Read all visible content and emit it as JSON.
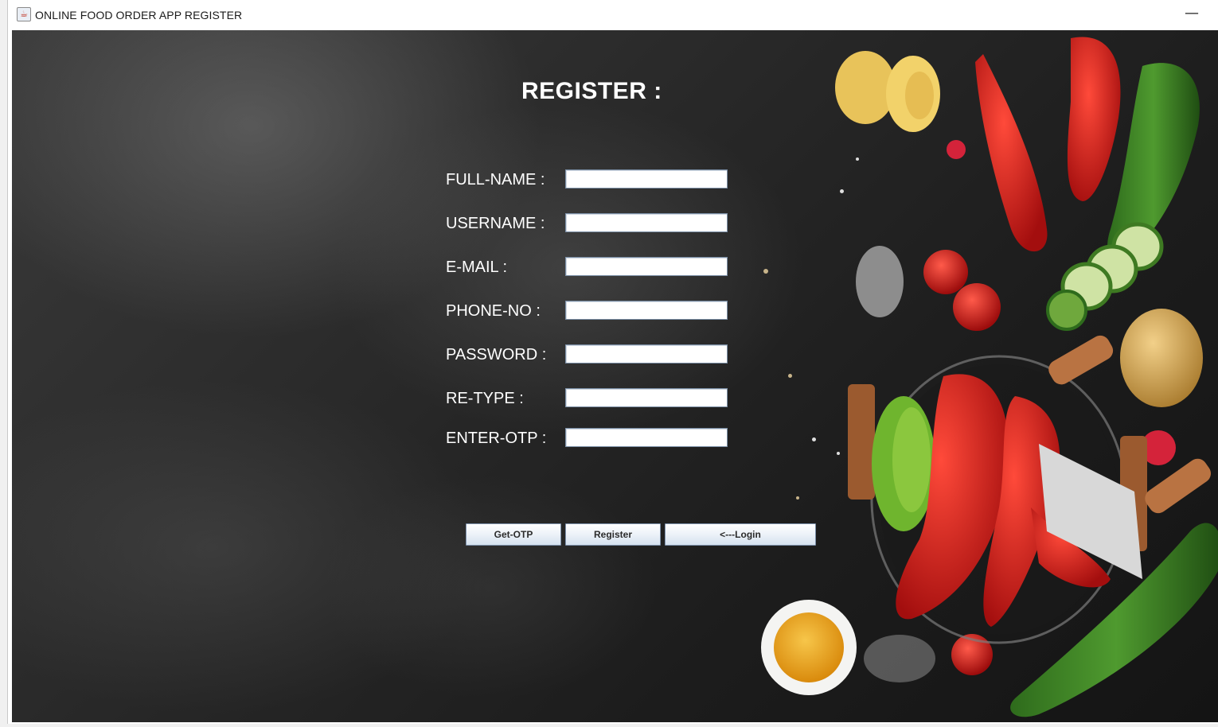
{
  "window": {
    "title": "ONLINE FOOD ORDER APP REGISTER",
    "minimize_glyph": "—"
  },
  "form": {
    "heading": "REGISTER :",
    "fields": [
      {
        "label": "FULL-NAME :",
        "value": ""
      },
      {
        "label": "USERNAME :",
        "value": ""
      },
      {
        "label": "E-MAIL :",
        "value": ""
      },
      {
        "label": "PHONE-NO :",
        "value": ""
      },
      {
        "label": "PASSWORD :",
        "value": ""
      },
      {
        "label": "RE-TYPE :",
        "value": ""
      },
      {
        "label": "ENTER-OTP :",
        "value": ""
      }
    ]
  },
  "buttons": {
    "get_otp": "Get-OTP",
    "register": "Register",
    "login": "<---Login"
  },
  "icons": {
    "app": "java-coffee-cup-icon",
    "minimize": "minimize-icon"
  },
  "colors": {
    "background_dark": "#262626",
    "text": "#ffffff",
    "button_border": "#7d91ab",
    "field_border": "#7a8ea5"
  }
}
